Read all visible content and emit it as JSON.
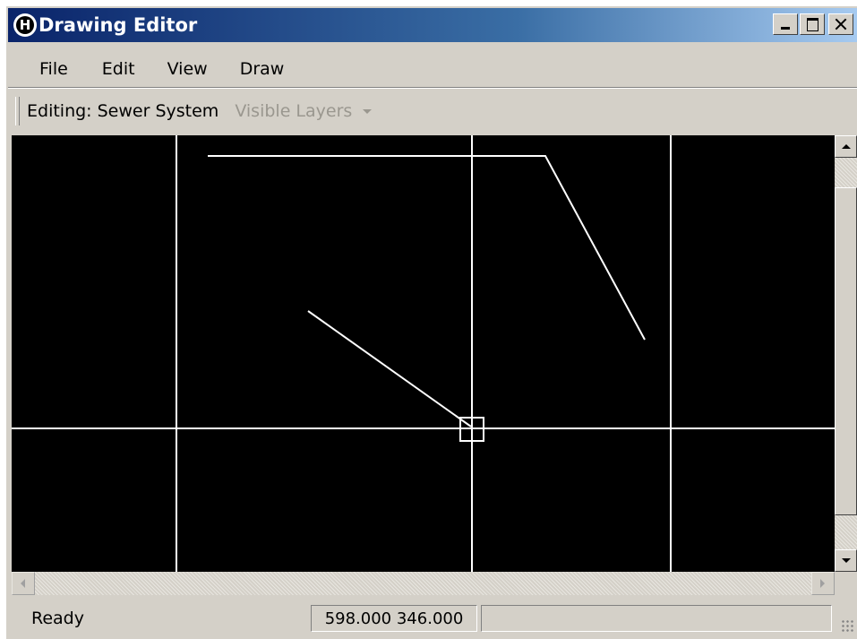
{
  "window": {
    "title": "Drawing Editor",
    "app_icon_glyph": "H"
  },
  "menu": {
    "items": [
      "File",
      "Edit",
      "View",
      "Draw"
    ]
  },
  "toolbar": {
    "editing_label": "Editing: Sewer System",
    "layers_dropdown": "Visible Layers"
  },
  "canvas": {
    "background": "#000000",
    "line_color": "#ffffff"
  },
  "statusbar": {
    "status": "Ready",
    "coordinates": "598.000 346.000",
    "extra": ""
  },
  "colors": {
    "titlebar_start": "#0a246a",
    "titlebar_end": "#a6caf0",
    "chrome": "#d4d0c8"
  }
}
